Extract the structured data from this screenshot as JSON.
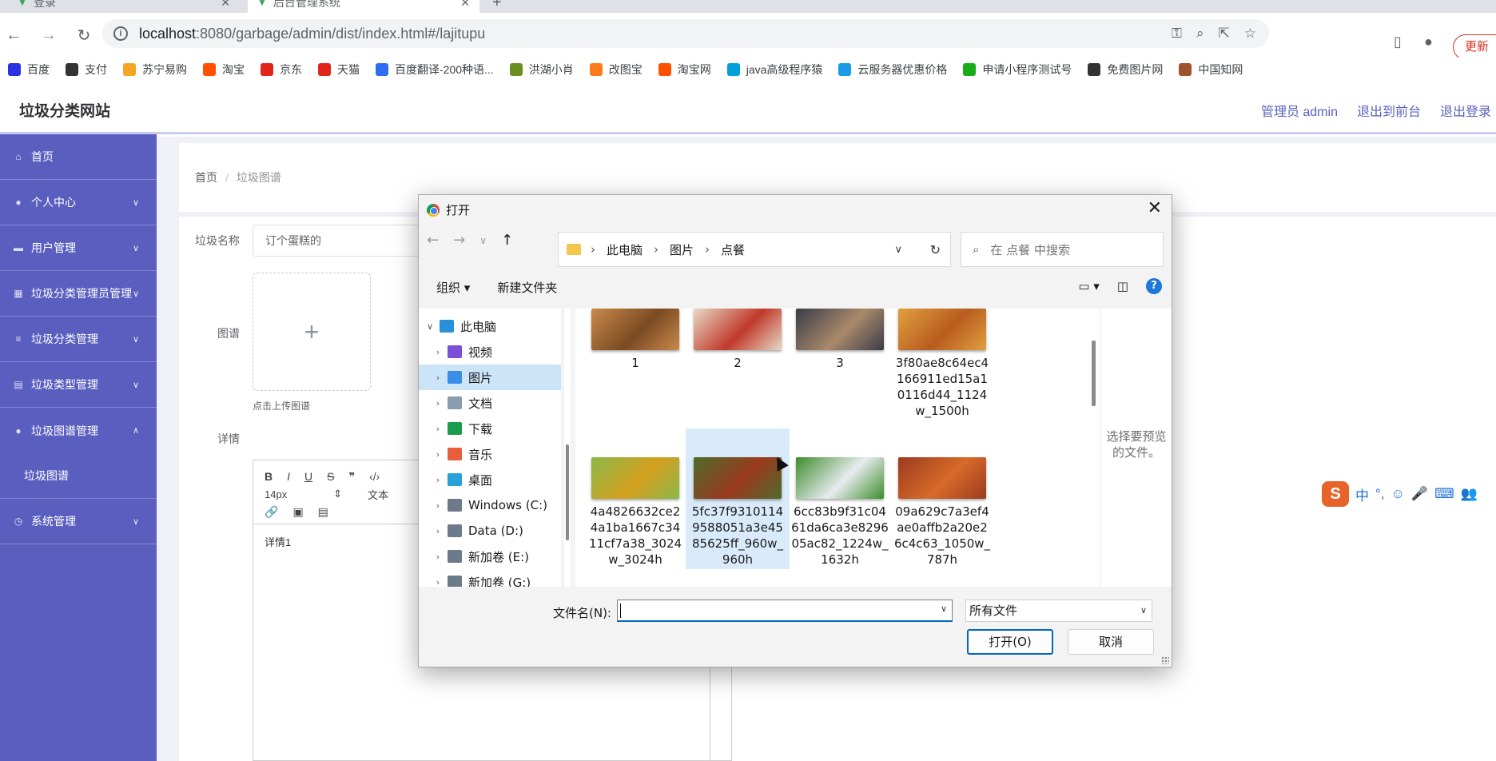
{
  "browser": {
    "tabs": [
      {
        "label": "登录"
      },
      {
        "label": "后台管理系统"
      }
    ],
    "url_host": "localhost",
    "url_path": ":8080/garbage/admin/dist/index.html#/lajitupu",
    "update_label": "更新",
    "bookmarks": [
      {
        "label": "百度",
        "color": "#2932e1"
      },
      {
        "label": "支付",
        "color": "#333333"
      },
      {
        "label": "苏宁易购",
        "color": "#f5a623"
      },
      {
        "label": "淘宝",
        "color": "#ff5000"
      },
      {
        "label": "京东",
        "color": "#e1251b"
      },
      {
        "label": "天猫",
        "color": "#e1251b"
      },
      {
        "label": "百度翻译-200种语...",
        "color": "#2d6ef0"
      },
      {
        "label": "洪湖小肖",
        "color": "#6b8e23"
      },
      {
        "label": "改图宝",
        "color": "#ff7a1a"
      },
      {
        "label": "淘宝网",
        "color": "#ff5000"
      },
      {
        "label": "java高级程序猿",
        "color": "#00a1d6"
      },
      {
        "label": "云服务器优惠价格",
        "color": "#1a9be5"
      },
      {
        "label": "申请小程序测试号",
        "color": "#1aad19"
      },
      {
        "label": "免费图片网",
        "color": "#333333"
      },
      {
        "label": "中国知网",
        "color": "#a0522d"
      }
    ]
  },
  "app": {
    "site_title": "垃圾分类网站",
    "header_links": [
      "管理员 admin",
      "退出到前台",
      "退出登录"
    ],
    "menu": [
      {
        "label": "首页",
        "icon": "home-icon",
        "arrow": ""
      },
      {
        "label": "个人中心",
        "icon": "user-icon",
        "arrow": "∨"
      },
      {
        "label": "用户管理",
        "icon": "users-icon",
        "arrow": "∨"
      },
      {
        "label": "垃圾分类管理员管理",
        "icon": "grid-icon",
        "arrow": "∨"
      },
      {
        "label": "垃圾分类管理",
        "icon": "list-icon",
        "arrow": "∨"
      },
      {
        "label": "垃圾类型管理",
        "icon": "clipboard-icon",
        "arrow": "∨"
      },
      {
        "label": "垃圾图谱管理",
        "icon": "map-pin-icon",
        "arrow": "∧"
      },
      {
        "label": "垃圾图谱",
        "icon": "",
        "arrow": ""
      },
      {
        "label": "系统管理",
        "icon": "clock-icon",
        "arrow": "∨"
      }
    ],
    "breadcrumb": {
      "home": "首页",
      "current": "垃圾图谱"
    },
    "form": {
      "name_label": "垃圾名称",
      "name_value": "订个蛋糕的",
      "image_label": "图谱",
      "upload_tip": "点击上传图谱",
      "detail_label": "详情",
      "font_size": "14px",
      "text_style": "文本",
      "editor_content": "详情1"
    }
  },
  "dialog": {
    "title": "打开",
    "path": [
      "此电脑",
      "图片",
      "点餐"
    ],
    "search_placeholder": "在 点餐 中搜索",
    "organize_label": "组织 ▾",
    "new_folder_label": "新建文件夹",
    "tree": [
      {
        "label": "此电脑",
        "color": "#2a8fd9",
        "chev": "∨",
        "indent": 0
      },
      {
        "label": "视频",
        "color": "#7b4fd6",
        "chev": "›",
        "indent": 1
      },
      {
        "label": "图片",
        "color": "#3a8ee6",
        "chev": "›",
        "indent": 1,
        "selected": true
      },
      {
        "label": "文档",
        "color": "#8a9bb0",
        "chev": "›",
        "indent": 1
      },
      {
        "label": "下载",
        "color": "#1a9c4c",
        "chev": "›",
        "indent": 1
      },
      {
        "label": "音乐",
        "color": "#e85d3a",
        "chev": "›",
        "indent": 1
      },
      {
        "label": "桌面",
        "color": "#2aa0d8",
        "chev": "›",
        "indent": 1
      },
      {
        "label": "Windows (C:)",
        "color": "#6c7a89",
        "chev": "›",
        "indent": 1
      },
      {
        "label": "Data (D:)",
        "color": "#6c7a89",
        "chev": "›",
        "indent": 1
      },
      {
        "label": "新加卷 (E:)",
        "color": "#6c7a89",
        "chev": "›",
        "indent": 1
      },
      {
        "label": "新加卷 (G:)",
        "color": "#6c7a89",
        "chev": "›",
        "indent": 1
      }
    ],
    "files": [
      {
        "name": "1",
        "colors": [
          "#c98a4b",
          "#7a4a22"
        ]
      },
      {
        "name": "2",
        "colors": [
          "#e8d9c5",
          "#c0392b"
        ]
      },
      {
        "name": "3",
        "colors": [
          "#3b3b4a",
          "#a88a6a"
        ]
      },
      {
        "name": "3f80ae8c64ec4166911ed15a10116d44_1124w_1500h",
        "colors": [
          "#e0a040",
          "#b85c1e"
        ]
      },
      {
        "name": "4a4826632ce24a1ba1667c3411cf7a38_3024w_3024h",
        "colors": [
          "#8ab848",
          "#d4a020"
        ]
      },
      {
        "name": "5fc37f93101149588051a3e4585625ff_960w_960h",
        "colors": [
          "#4d6b2a",
          "#9a3a1e"
        ],
        "selected": true
      },
      {
        "name": "6cc83b9f31c0461da6ca3e829605ac82_1224w_1632h",
        "colors": [
          "#3c8c2c",
          "#e8ecef"
        ]
      },
      {
        "name": "09a629c7a3ef4ae0affb2a20e26c4c63_1050w_787h",
        "colors": [
          "#9a3a1e",
          "#d86a2a"
        ]
      }
    ],
    "preview_text": "选择要预览的文件。",
    "filename_label": "文件名(N):",
    "filename_value": "",
    "filetype_value": "所有文件",
    "open_label": "打开(O)",
    "cancel_label": "取消"
  },
  "ime": {
    "logo": "S",
    "items": [
      "中",
      "°,",
      "☺",
      "🎤",
      "⌨",
      "👥"
    ]
  }
}
